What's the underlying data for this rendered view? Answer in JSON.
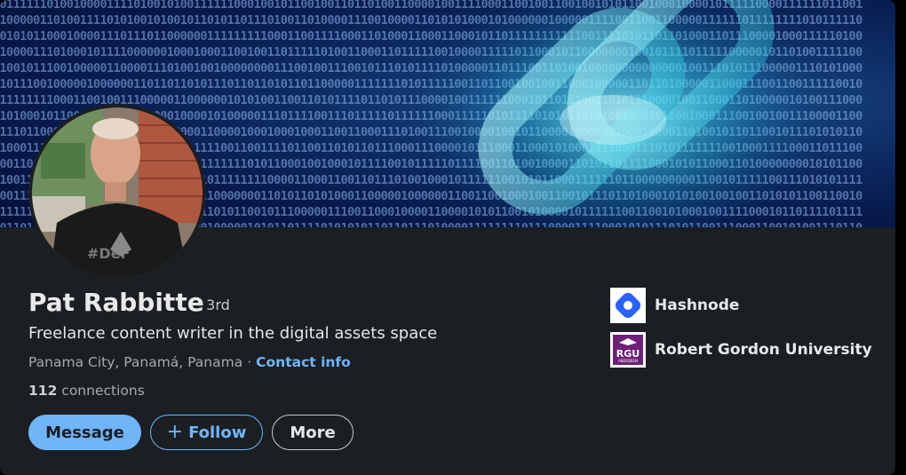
{
  "profile": {
    "name": "Pat Rabbitte",
    "degree": "· 3rd",
    "headline": "Freelance content writer in the digital assets space",
    "location": "Panama City, Panamá, Panama",
    "separator": "·",
    "contact_info_label": "Contact info",
    "connections_count": "112",
    "connections_label": "connections"
  },
  "actions": {
    "message_label": "Message",
    "follow_label": "Follow",
    "more_label": "More"
  },
  "organizations": [
    {
      "name": "Hashnode",
      "logo_icon": "hashnode-logo"
    },
    {
      "name": "Robert Gordon University",
      "logo_icon": "rgu-logo",
      "logo_text_main": "RGU",
      "logo_text_sub": "ABERDEEN"
    }
  ],
  "banner": {
    "icon": "blockchain-link-icon"
  },
  "colors": {
    "card_background": "#1b1f23",
    "accent_blue": "#70b5f9",
    "hashnode_blue": "#2962ff",
    "rgu_purple": "#6d2077"
  }
}
